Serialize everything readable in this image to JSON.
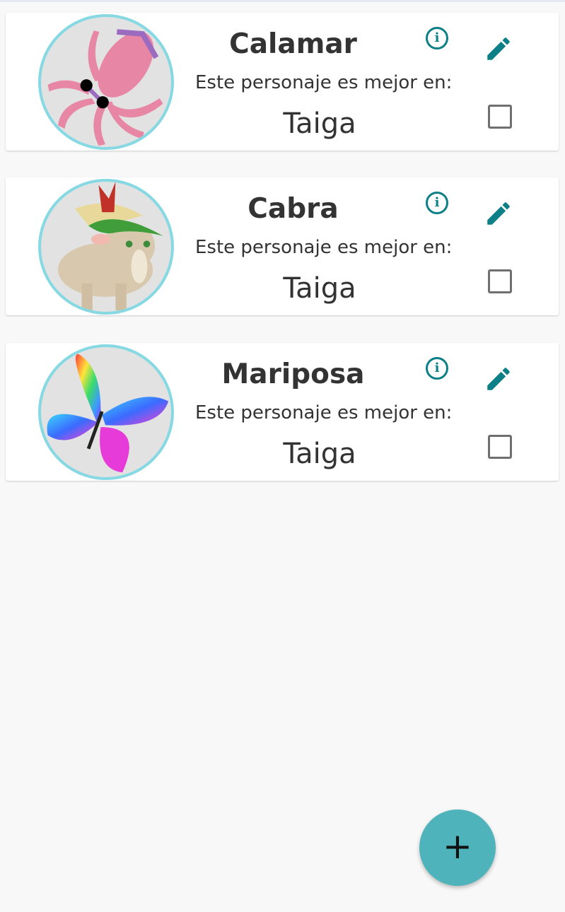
{
  "characters": [
    {
      "name": "Calamar",
      "subtitle": "Este personaje es mejor en:",
      "biome": "Taiga",
      "avatar": "squid-image",
      "checked": false
    },
    {
      "name": "Cabra",
      "subtitle": "Este personaje es mejor en:",
      "biome": "Taiga",
      "avatar": "goat-image",
      "checked": false
    },
    {
      "name": "Mariposa",
      "subtitle": "Este personaje es mejor en:",
      "biome": "Taiga",
      "avatar": "butterfly-image",
      "checked": false
    }
  ],
  "icons": {
    "info": "i",
    "fab": "+"
  },
  "colors": {
    "accent": "#0d7f86",
    "fab": "#4fb3bc",
    "avatar_border": "#86d9e3"
  }
}
